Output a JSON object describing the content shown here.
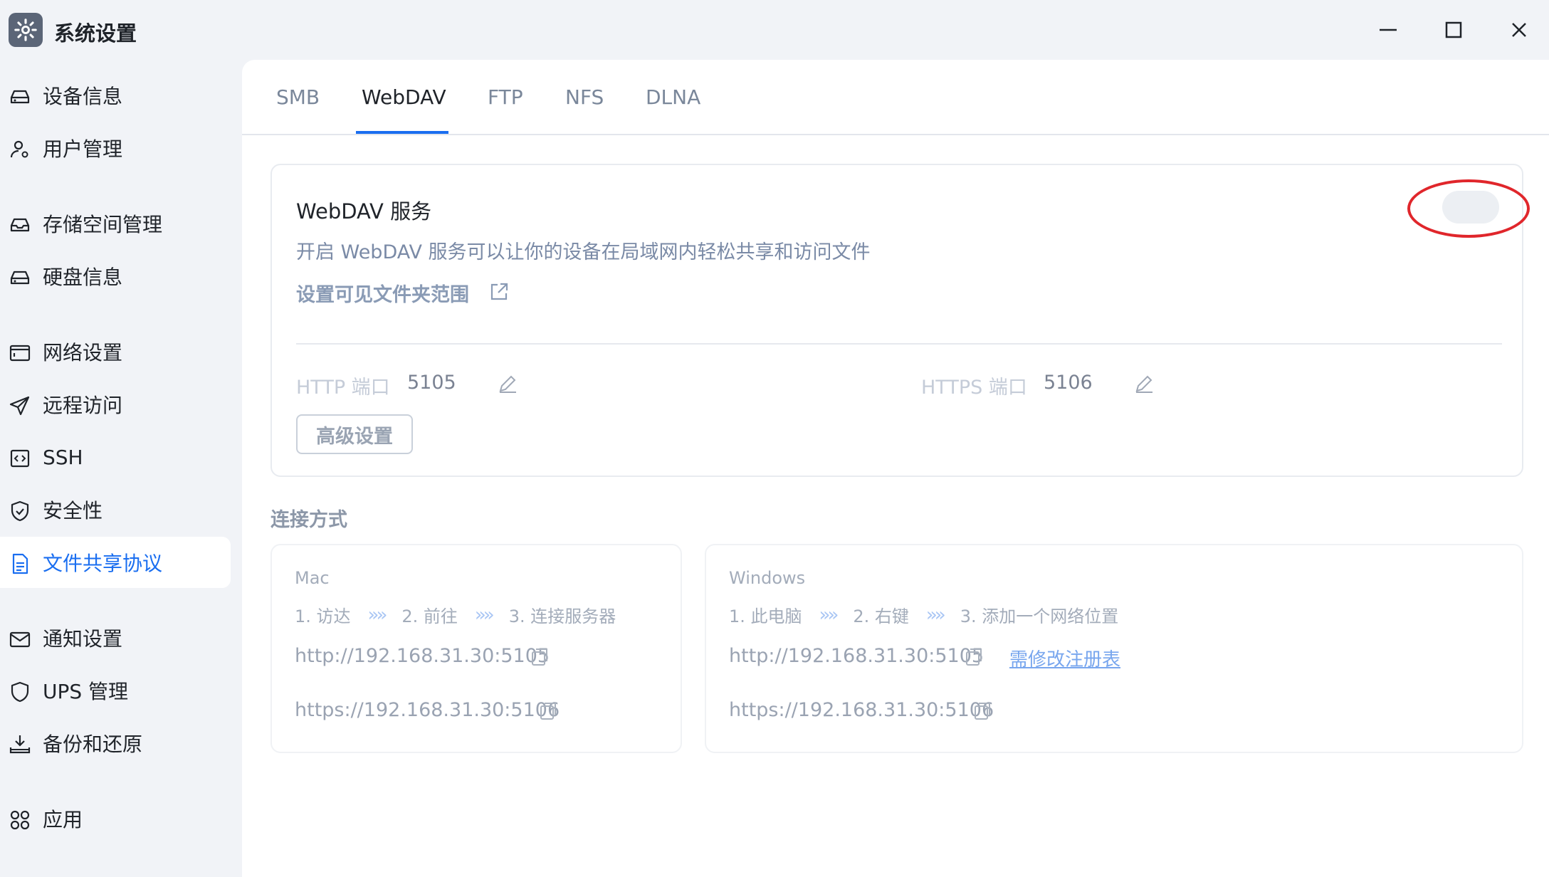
{
  "window": {
    "title": "系统设置"
  },
  "sidebar": {
    "items": [
      {
        "label": "设备信息",
        "icon": "hard-drive-icon"
      },
      {
        "label": "用户管理",
        "icon": "user-settings-icon"
      },
      {
        "label": "存储空间管理",
        "icon": "inbox-icon"
      },
      {
        "label": "硬盘信息",
        "icon": "hard-drive-icon"
      },
      {
        "label": "网络设置",
        "icon": "network-window-icon"
      },
      {
        "label": "远程访问",
        "icon": "send-icon"
      },
      {
        "label": "SSH",
        "icon": "code-box-icon"
      },
      {
        "label": "安全性",
        "icon": "shield-check-icon"
      },
      {
        "label": "文件共享协议",
        "icon": "document-icon",
        "active": true
      },
      {
        "label": "通知设置",
        "icon": "mail-icon"
      },
      {
        "label": "UPS 管理",
        "icon": "shield-icon"
      },
      {
        "label": "备份和还原",
        "icon": "download-tray-icon"
      },
      {
        "label": "应用",
        "icon": "apps-grid-icon"
      }
    ]
  },
  "tabs": [
    {
      "label": "SMB"
    },
    {
      "label": "WebDAV",
      "active": true
    },
    {
      "label": "FTP"
    },
    {
      "label": "NFS"
    },
    {
      "label": "DLNA"
    }
  ],
  "service": {
    "title": "WebDAV 服务",
    "description": "开启 WebDAV 服务可以让你的设备在局域网内轻松共享和访问文件",
    "folder_link": "设置可见文件夹范围",
    "enabled": false,
    "http_label": "HTTP 端口",
    "http_port": "5105",
    "https_label": "HTTPS 端口",
    "https_port": "5106",
    "advanced_button": "高级设置"
  },
  "connection": {
    "title": "连接方式",
    "mac": {
      "name": "Mac",
      "steps": [
        "1. 访达",
        "2. 前往",
        "3. 连接服务器"
      ],
      "http_url": "http://192.168.31.30:5105",
      "https_url": "https://192.168.31.30:5106"
    },
    "windows": {
      "name": "Windows",
      "steps": [
        "1. 此电脑",
        "2. 右键",
        "3. 添加一个网络位置"
      ],
      "http_url": "http://192.168.31.30:5105",
      "https_url": "https://192.168.31.30:5106",
      "registry_link": "需修改注册表"
    },
    "step_separator": "»»"
  },
  "colors": {
    "accent": "#1a6ef0",
    "highlight_circle": "#e0262b"
  }
}
